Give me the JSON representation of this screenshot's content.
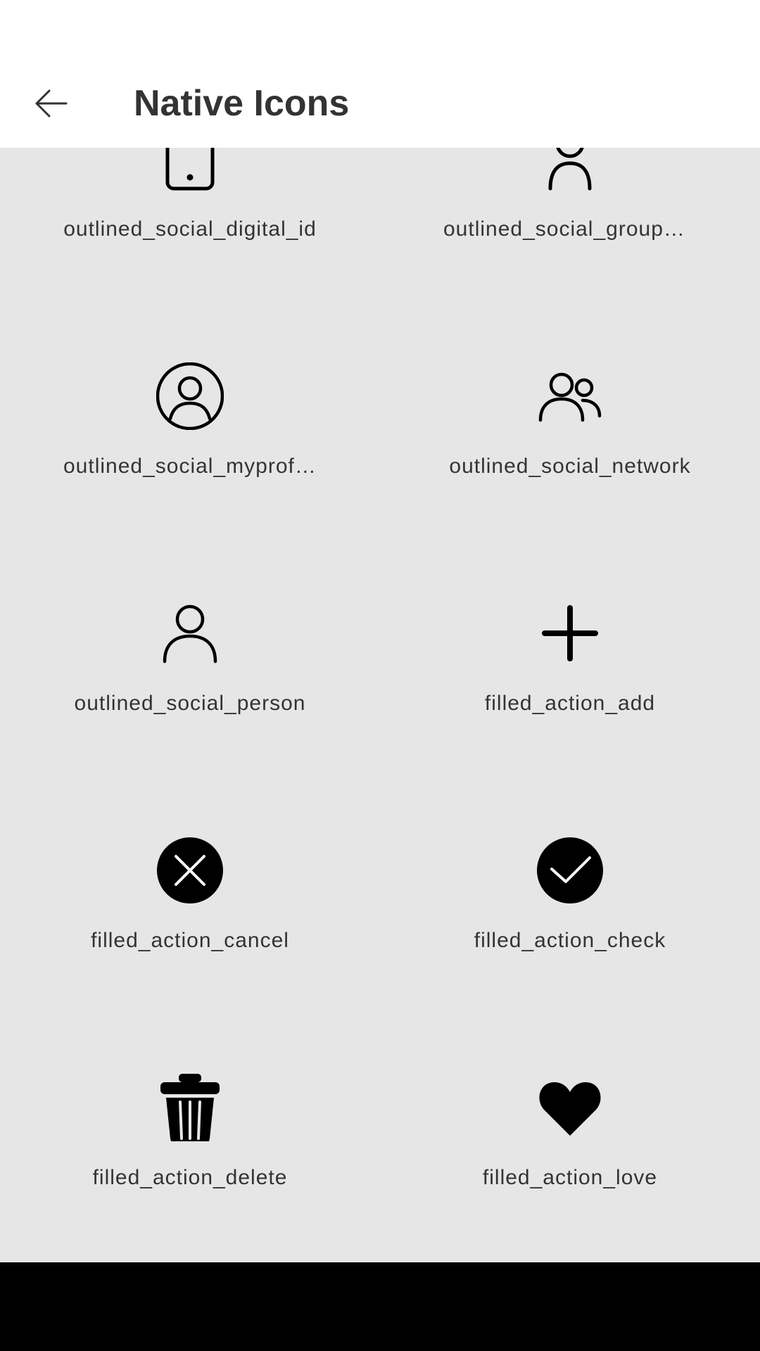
{
  "app_bar": {
    "title": "Native Icons",
    "back_icon": "arrow-left-icon"
  },
  "icons": [
    {
      "label": "outlined_social_digital_id",
      "icon": "digital-id-icon"
    },
    {
      "label": "outlined_social_group_add",
      "icon": "group-icon"
    },
    {
      "label": "outlined_social_myprofile",
      "icon": "account-circle-icon"
    },
    {
      "label": "outlined_social_network",
      "icon": "people-icon"
    },
    {
      "label": "outlined_social_person",
      "icon": "person-icon"
    },
    {
      "label": "filled_action_add",
      "icon": "plus-icon"
    },
    {
      "label": "filled_action_cancel",
      "icon": "cancel-circle-icon"
    },
    {
      "label": "filled_action_check",
      "icon": "check-circle-icon"
    },
    {
      "label": "filled_action_delete",
      "icon": "trash-icon"
    },
    {
      "label": "filled_action_love",
      "icon": "heart-icon"
    }
  ],
  "colors": {
    "app_bar_background": "#ffffff",
    "content_background": "#e6e6e6",
    "title_text": "#333333",
    "label_text": "#333333",
    "icon": "#000000",
    "nav_bar": "#000000"
  }
}
